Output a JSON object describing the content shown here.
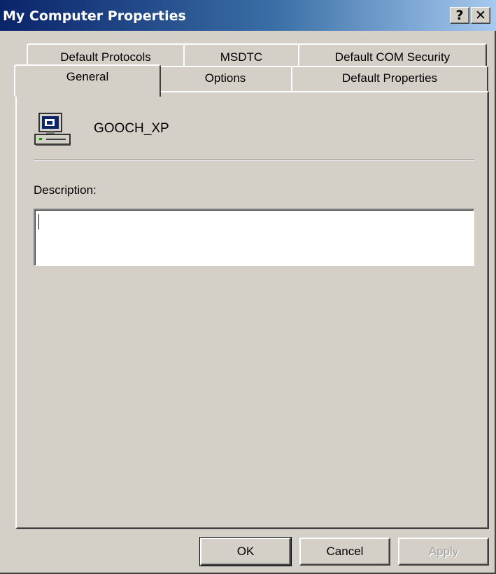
{
  "window": {
    "title": "My Computer Properties",
    "help_label": "?",
    "close_label": "✕"
  },
  "tabs": {
    "row1": [
      "Default Protocols",
      "MSDTC",
      "Default COM Security"
    ],
    "row2": [
      "General",
      "Options",
      "Default Properties"
    ],
    "active": "General"
  },
  "general": {
    "computer_icon": "computer-icon",
    "computer_name": "GOOCH_XP",
    "description_label": "Description:",
    "description_value": ""
  },
  "buttons": {
    "ok": "OK",
    "cancel": "Cancel",
    "apply": "Apply"
  },
  "colors": {
    "face": "#d4d0c8",
    "title_start": "#0a246a",
    "title_end": "#a6caf0"
  }
}
